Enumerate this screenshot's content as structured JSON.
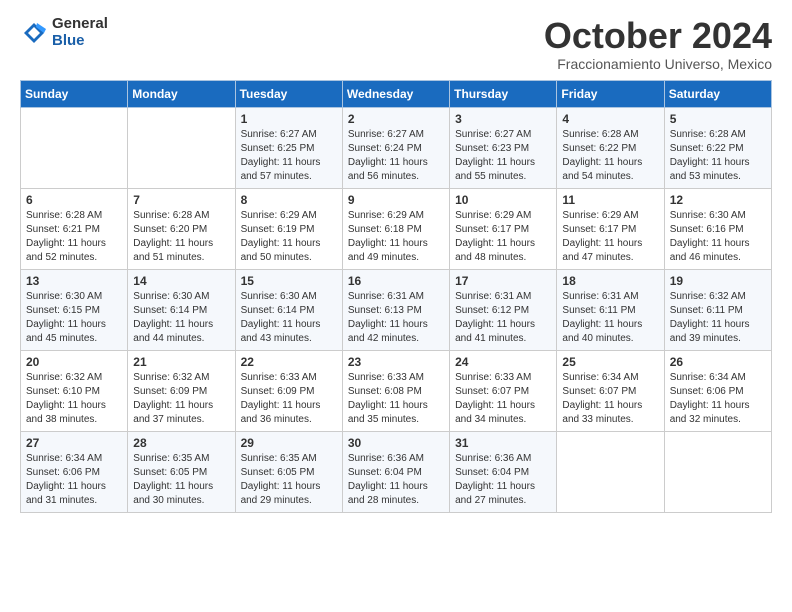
{
  "logo": {
    "general": "General",
    "blue": "Blue"
  },
  "title": "October 2024",
  "subtitle": "Fraccionamiento Universo, Mexico",
  "days_of_week": [
    "Sunday",
    "Monday",
    "Tuesday",
    "Wednesday",
    "Thursday",
    "Friday",
    "Saturday"
  ],
  "weeks": [
    [
      {
        "day": "",
        "info": ""
      },
      {
        "day": "",
        "info": ""
      },
      {
        "day": "1",
        "info": "Sunrise: 6:27 AM\nSunset: 6:25 PM\nDaylight: 11 hours and 57 minutes."
      },
      {
        "day": "2",
        "info": "Sunrise: 6:27 AM\nSunset: 6:24 PM\nDaylight: 11 hours and 56 minutes."
      },
      {
        "day": "3",
        "info": "Sunrise: 6:27 AM\nSunset: 6:23 PM\nDaylight: 11 hours and 55 minutes."
      },
      {
        "day": "4",
        "info": "Sunrise: 6:28 AM\nSunset: 6:22 PM\nDaylight: 11 hours and 54 minutes."
      },
      {
        "day": "5",
        "info": "Sunrise: 6:28 AM\nSunset: 6:22 PM\nDaylight: 11 hours and 53 minutes."
      }
    ],
    [
      {
        "day": "6",
        "info": "Sunrise: 6:28 AM\nSunset: 6:21 PM\nDaylight: 11 hours and 52 minutes."
      },
      {
        "day": "7",
        "info": "Sunrise: 6:28 AM\nSunset: 6:20 PM\nDaylight: 11 hours and 51 minutes."
      },
      {
        "day": "8",
        "info": "Sunrise: 6:29 AM\nSunset: 6:19 PM\nDaylight: 11 hours and 50 minutes."
      },
      {
        "day": "9",
        "info": "Sunrise: 6:29 AM\nSunset: 6:18 PM\nDaylight: 11 hours and 49 minutes."
      },
      {
        "day": "10",
        "info": "Sunrise: 6:29 AM\nSunset: 6:17 PM\nDaylight: 11 hours and 48 minutes."
      },
      {
        "day": "11",
        "info": "Sunrise: 6:29 AM\nSunset: 6:17 PM\nDaylight: 11 hours and 47 minutes."
      },
      {
        "day": "12",
        "info": "Sunrise: 6:30 AM\nSunset: 6:16 PM\nDaylight: 11 hours and 46 minutes."
      }
    ],
    [
      {
        "day": "13",
        "info": "Sunrise: 6:30 AM\nSunset: 6:15 PM\nDaylight: 11 hours and 45 minutes."
      },
      {
        "day": "14",
        "info": "Sunrise: 6:30 AM\nSunset: 6:14 PM\nDaylight: 11 hours and 44 minutes."
      },
      {
        "day": "15",
        "info": "Sunrise: 6:30 AM\nSunset: 6:14 PM\nDaylight: 11 hours and 43 minutes."
      },
      {
        "day": "16",
        "info": "Sunrise: 6:31 AM\nSunset: 6:13 PM\nDaylight: 11 hours and 42 minutes."
      },
      {
        "day": "17",
        "info": "Sunrise: 6:31 AM\nSunset: 6:12 PM\nDaylight: 11 hours and 41 minutes."
      },
      {
        "day": "18",
        "info": "Sunrise: 6:31 AM\nSunset: 6:11 PM\nDaylight: 11 hours and 40 minutes."
      },
      {
        "day": "19",
        "info": "Sunrise: 6:32 AM\nSunset: 6:11 PM\nDaylight: 11 hours and 39 minutes."
      }
    ],
    [
      {
        "day": "20",
        "info": "Sunrise: 6:32 AM\nSunset: 6:10 PM\nDaylight: 11 hours and 38 minutes."
      },
      {
        "day": "21",
        "info": "Sunrise: 6:32 AM\nSunset: 6:09 PM\nDaylight: 11 hours and 37 minutes."
      },
      {
        "day": "22",
        "info": "Sunrise: 6:33 AM\nSunset: 6:09 PM\nDaylight: 11 hours and 36 minutes."
      },
      {
        "day": "23",
        "info": "Sunrise: 6:33 AM\nSunset: 6:08 PM\nDaylight: 11 hours and 35 minutes."
      },
      {
        "day": "24",
        "info": "Sunrise: 6:33 AM\nSunset: 6:07 PM\nDaylight: 11 hours and 34 minutes."
      },
      {
        "day": "25",
        "info": "Sunrise: 6:34 AM\nSunset: 6:07 PM\nDaylight: 11 hours and 33 minutes."
      },
      {
        "day": "26",
        "info": "Sunrise: 6:34 AM\nSunset: 6:06 PM\nDaylight: 11 hours and 32 minutes."
      }
    ],
    [
      {
        "day": "27",
        "info": "Sunrise: 6:34 AM\nSunset: 6:06 PM\nDaylight: 11 hours and 31 minutes."
      },
      {
        "day": "28",
        "info": "Sunrise: 6:35 AM\nSunset: 6:05 PM\nDaylight: 11 hours and 30 minutes."
      },
      {
        "day": "29",
        "info": "Sunrise: 6:35 AM\nSunset: 6:05 PM\nDaylight: 11 hours and 29 minutes."
      },
      {
        "day": "30",
        "info": "Sunrise: 6:36 AM\nSunset: 6:04 PM\nDaylight: 11 hours and 28 minutes."
      },
      {
        "day": "31",
        "info": "Sunrise: 6:36 AM\nSunset: 6:04 PM\nDaylight: 11 hours and 27 minutes."
      },
      {
        "day": "",
        "info": ""
      },
      {
        "day": "",
        "info": ""
      }
    ]
  ]
}
